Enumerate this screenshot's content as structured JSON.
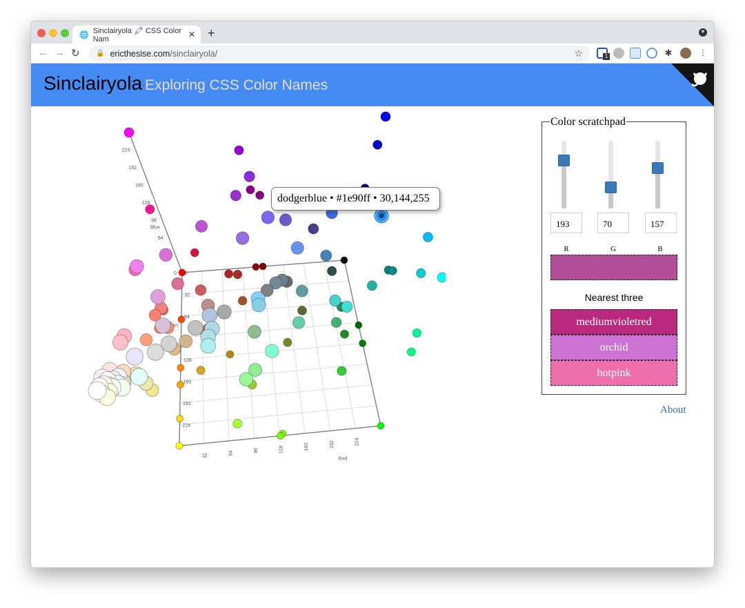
{
  "browser": {
    "tab_title": "Sinclairyola 🖍 CSS Color Nam",
    "url_domain": "ericthesise.com",
    "url_path": "/sinclairyola/",
    "ext_badge": "1"
  },
  "header": {
    "title": "Sinclairyola",
    "subtitle": "Exploring CSS Color Names"
  },
  "tooltip": {
    "text": "dodgerblue • #1e90ff • 30,144,255"
  },
  "scratchpad": {
    "legend": "Color scratchpad",
    "r": 193,
    "g": 70,
    "b": 157,
    "r_label": "R",
    "g_label": "G",
    "b_label": "B",
    "swatch_color": "#b24e98",
    "nearest_title": "Nearest three",
    "nearest": [
      {
        "name": "mediumvioletred",
        "color": "#b92a7e"
      },
      {
        "name": "orchid",
        "color": "#cb72d2"
      },
      {
        "name": "hotpink",
        "color": "#ee6eae"
      }
    ]
  },
  "about_label": "About",
  "chart_data": {
    "type": "scatter",
    "title": "",
    "axes": [
      {
        "label": "Red",
        "range": [
          0,
          255
        ]
      },
      {
        "label": "Green",
        "range": [
          0,
          255
        ]
      },
      {
        "label": "Blue",
        "range": [
          0,
          255
        ]
      }
    ],
    "ticks": [
      0,
      32,
      64,
      96,
      128,
      160,
      192,
      224
    ],
    "highlighted": "dodgerblue",
    "points": [
      [
        "black",
        "#000000"
      ],
      [
        "red",
        "#ff0000"
      ],
      [
        "lime",
        "#00ff00"
      ],
      [
        "blue",
        "#0000ff"
      ],
      [
        "yellow",
        "#ffff00"
      ],
      [
        "magenta",
        "#ff00ff"
      ],
      [
        "aqua",
        "#00ffff"
      ],
      [
        "mediumblue",
        "#0000cd"
      ],
      [
        "darkviolet",
        "#9400d3"
      ],
      [
        "blueviolet",
        "#8a2be2"
      ],
      [
        "darkorchid",
        "#9932cc"
      ],
      [
        "purple",
        "#800080"
      ],
      [
        "darkmagenta",
        "#8b008b"
      ],
      [
        "mediumslateblue",
        "#7b68ee"
      ],
      [
        "slateblue",
        "#6a5acd"
      ],
      [
        "mediumpurple",
        "#9370db"
      ],
      [
        "royalblue",
        "#4169e1"
      ],
      [
        "navy",
        "#000080"
      ],
      [
        "darkslateblue",
        "#483d8b"
      ],
      [
        "cornflowerblue",
        "#6495ed"
      ],
      [
        "dodgerblue",
        "#1e90ff"
      ],
      [
        "deepskyblue",
        "#00bfff"
      ],
      [
        "mediumorchid",
        "#ba55d3"
      ],
      [
        "violet",
        "#ee82ee"
      ],
      [
        "orchid",
        "#da70d6"
      ],
      [
        "deeppink",
        "#ff1493"
      ],
      [
        "hotpink",
        "#ff69b4"
      ],
      [
        "crimson",
        "#dc143c"
      ],
      [
        "maroon",
        "#800000"
      ],
      [
        "darkred",
        "#8b0000"
      ],
      [
        "brown",
        "#a52a2a"
      ],
      [
        "firebrick",
        "#b22222"
      ],
      [
        "indianred",
        "#cd5c5c"
      ],
      [
        "palevioletred",
        "#db7093"
      ],
      [
        "plum",
        "#dda0dd"
      ],
      [
        "thistle",
        "#d8bfd8"
      ],
      [
        "salmon",
        "#fa8072"
      ],
      [
        "lightcoral",
        "#f08080"
      ],
      [
        "tomato",
        "#ff6347"
      ],
      [
        "orangered",
        "#ff4500"
      ],
      [
        "coral",
        "#ff7f50"
      ],
      [
        "darksalmon",
        "#e9967a"
      ],
      [
        "lightsalmon",
        "#ffa07a"
      ],
      [
        "sienna",
        "#a0522d"
      ],
      [
        "saddlebrown",
        "#8b4513"
      ],
      [
        "chocolate",
        "#d2691e"
      ],
      [
        "peru",
        "#cd853f"
      ],
      [
        "darkorange",
        "#ff8c00"
      ],
      [
        "orange",
        "#ffa500"
      ],
      [
        "goldenrod",
        "#daa520"
      ],
      [
        "darkgoldenrod",
        "#b8860b"
      ],
      [
        "gold",
        "#ffd700"
      ],
      [
        "tan",
        "#d2b48c"
      ],
      [
        "burlywood",
        "#deb887"
      ],
      [
        "rosybrown",
        "#bc8f8f"
      ],
      [
        "gray",
        "#808080"
      ],
      [
        "dimgray",
        "#696969"
      ],
      [
        "darkgray",
        "#a9a9a9"
      ],
      [
        "silver",
        "#c0c0c0"
      ],
      [
        "lightgray",
        "#d3d3d3"
      ],
      [
        "gainsboro",
        "#dcdcdc"
      ],
      [
        "slategray",
        "#708090"
      ],
      [
        "lightslategray",
        "#778899"
      ],
      [
        "steelblue",
        "#4682b4"
      ],
      [
        "darkslategray",
        "#2f4f4f"
      ],
      [
        "lightsteelblue",
        "#b0c4de"
      ],
      [
        "lightskyblue",
        "#87cefa"
      ],
      [
        "skyblue",
        "#87ceeb"
      ],
      [
        "lightblue",
        "#add8e6"
      ],
      [
        "powderblue",
        "#b0e0e6"
      ],
      [
        "paleturquoise",
        "#afeeee"
      ],
      [
        "cadetblue",
        "#5f9ea0"
      ],
      [
        "teal",
        "#008080"
      ],
      [
        "darkcyan",
        "#008b8b"
      ],
      [
        "lightseagreen",
        "#20b2aa"
      ],
      [
        "mediumturquoise",
        "#48d1cc"
      ],
      [
        "turquoise",
        "#40e0d0"
      ],
      [
        "darkturquoise",
        "#00ced1"
      ],
      [
        "darkolivegreen",
        "#556b2f"
      ],
      [
        "olive",
        "#808000"
      ],
      [
        "olivedrab",
        "#6b8e23"
      ],
      [
        "darkseagreen",
        "#8fbc8f"
      ],
      [
        "mediumaquamarine",
        "#66cdaa"
      ],
      [
        "seagreen",
        "#2e8b57"
      ],
      [
        "mediumseagreen",
        "#3cb371"
      ],
      [
        "green",
        "#008000"
      ],
      [
        "darkgreen",
        "#006400"
      ],
      [
        "forestgreen",
        "#228b22"
      ],
      [
        "limegreen",
        "#32cd32"
      ],
      [
        "yellowgreen",
        "#9acd32"
      ],
      [
        "lightgreen",
        "#90ee90"
      ],
      [
        "palegreen",
        "#98fb98"
      ],
      [
        "aquamarine",
        "#7fffd4"
      ],
      [
        "springgreen",
        "#00ff7f"
      ],
      [
        "mediumspringgreen",
        "#00fa9a"
      ],
      [
        "greenyellow",
        "#adff2f"
      ],
      [
        "chartreuse",
        "#7fff00"
      ],
      [
        "lawngreen",
        "#7cfc00"
      ],
      [
        "khaki",
        "#f0e68c"
      ],
      [
        "palegoldenrod",
        "#eee8aa"
      ],
      [
        "wheat",
        "#f5deb3"
      ],
      [
        "moccasin",
        "#ffe4b5"
      ],
      [
        "peachpuff",
        "#ffdab9"
      ],
      [
        "pink",
        "#ffc0cb"
      ],
      [
        "lightpink",
        "#ffb6c1"
      ],
      [
        "mistyrose",
        "#ffe4e1"
      ],
      [
        "lavender",
        "#e6e6fa"
      ],
      [
        "lavenderblush",
        "#fff0f5"
      ],
      [
        "ghostwhite",
        "#f8f8ff"
      ],
      [
        "aliceblue",
        "#f0f8ff"
      ],
      [
        "azure",
        "#f0ffff"
      ],
      [
        "lightcyan",
        "#e0ffff"
      ],
      [
        "honeydew",
        "#f0fff0"
      ],
      [
        "mintcream",
        "#f5fffa"
      ],
      [
        "ivory",
        "#fffff0"
      ],
      [
        "lightyellow",
        "#ffffe0"
      ],
      [
        "beige",
        "#f5f5dc"
      ],
      [
        "cornsilk",
        "#fff8dc"
      ],
      [
        "linen",
        "#faf0e6"
      ],
      [
        "seashell",
        "#fff5ee"
      ],
      [
        "snow",
        "#fffafa"
      ],
      [
        "white",
        "#ffffff"
      ],
      [
        "oldlace",
        "#fdf5e6"
      ],
      [
        "bisque",
        "#ffe4c4"
      ]
    ]
  }
}
